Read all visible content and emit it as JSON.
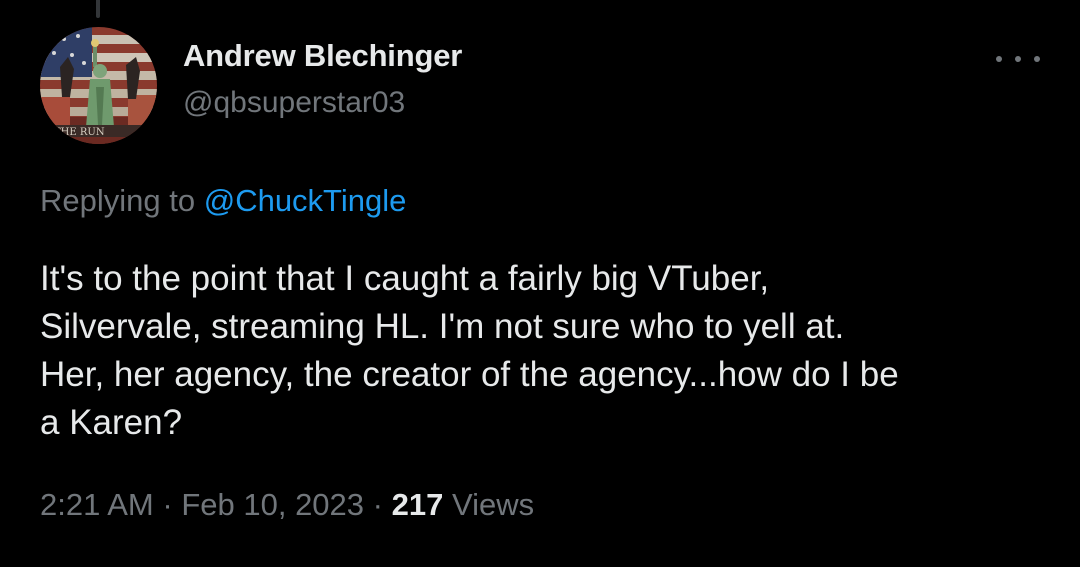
{
  "tweet": {
    "author": {
      "display_name": "Andrew Blechinger",
      "handle": "@qbsuperstar03"
    },
    "replying": {
      "prefix": "Replying to",
      "mention": "@ChuckTingle"
    },
    "text_lines": [
      "It's to the point that I caught a fairly big VTuber,",
      "Silvervale, streaming HL. I'm not sure who to yell at.",
      "Her, her agency, the creator of the agency...how do I be",
      "a Karen?"
    ],
    "meta": {
      "time": "2:21 AM",
      "separator": "·",
      "date": "Feb 10, 2023",
      "views_count": "217",
      "views_label": "Views"
    },
    "more_icon": "more-horizontal-icon"
  },
  "colors": {
    "background": "#000000",
    "primary_text": "#e7e9ea",
    "secondary_text": "#71767b",
    "accent": "#1d9bf0",
    "thread_line": "#333639"
  }
}
